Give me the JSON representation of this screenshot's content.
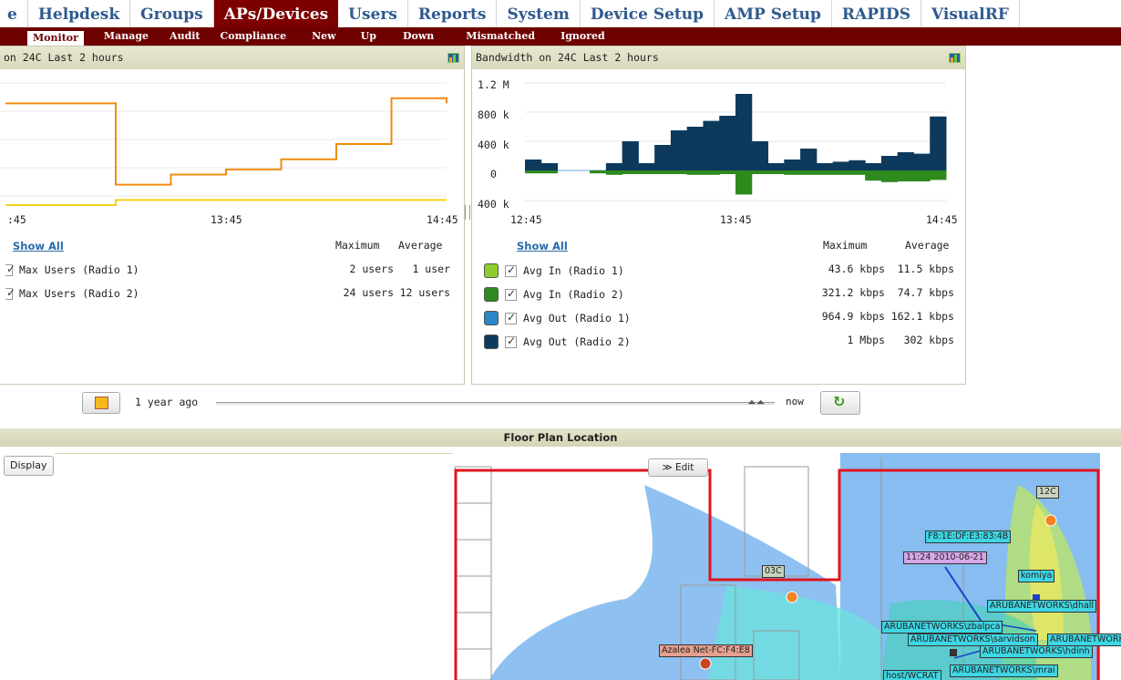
{
  "nav": {
    "tabs": [
      "e",
      "Helpdesk",
      "Groups",
      "APs/Devices",
      "Users",
      "Reports",
      "System",
      "Device Setup",
      "AMP Setup",
      "RAPIDS",
      "VisualRF"
    ],
    "active": "APs/Devices",
    "subtabs": [
      "Monitor",
      "Manage",
      "Audit",
      "Compliance",
      "New",
      "Up",
      "Down",
      "Mismatched",
      "Ignored"
    ],
    "active_sub": "Monitor"
  },
  "users_panel": {
    "title": "on 24C   Last 2 hours",
    "time_labels": [
      ":45",
      "13:45",
      "14:45"
    ],
    "show_all": "Show All",
    "col_max": "Maximum",
    "col_avg": "Average",
    "rows": [
      {
        "label": "Max Users (Radio 1)",
        "max": "2 users",
        "avg": "1 user",
        "color": "#f5d21a"
      },
      {
        "label": "Max Users (Radio 2)",
        "max": "24 users",
        "avg": "12 users",
        "color": "#f08c10"
      }
    ]
  },
  "bw_panel": {
    "title": "Bandwidth on 24C   Last 2 hours",
    "y_ticks": [
      "1.2 M",
      "800 k",
      "400 k",
      "0",
      "400 k"
    ],
    "time_labels": [
      "12:45",
      "13:45",
      "14:45"
    ],
    "show_all": "Show All",
    "col_max": "Maximum",
    "col_avg": "Average",
    "rows": [
      {
        "label": "Avg In (Radio 1)",
        "max": "43.6 kbps",
        "avg": "11.5 kbps",
        "color": "#8ccd2a"
      },
      {
        "label": "Avg In (Radio 2)",
        "max": "321.2 kbps",
        "avg": "74.7 kbps",
        "color": "#2f8a1e"
      },
      {
        "label": "Avg Out (Radio 1)",
        "max": "964.9 kbps",
        "avg": "162.1 kbps",
        "color": "#2a86c8"
      },
      {
        "label": "Avg Out (Radio 2)",
        "max": "1 Mbps",
        "avg": "302 kbps",
        "color": "#0d3a5c"
      }
    ]
  },
  "chart_data": [
    {
      "type": "line",
      "x": [
        "12:45",
        "13:00",
        "13:15",
        "13:30",
        "13:45",
        "14:00",
        "14:15",
        "14:30",
        "14:45"
      ],
      "series": [
        {
          "values": [
            20,
            20,
            4,
            6,
            7,
            9,
            12,
            21,
            20
          ],
          "color": "#f08c10"
        },
        {
          "values": [
            0,
            0,
            1,
            1,
            1,
            1,
            1,
            1,
            1
          ],
          "color": "#f5d21a"
        }
      ]
    },
    {
      "type": "bar",
      "y_ticks": [
        "1.2 M",
        "800 k",
        "400 k",
        "0",
        "400 k"
      ],
      "x_ticks": [
        "12:45",
        "13:45",
        "14:45"
      ],
      "series": [
        {
          "values": [
            150,
            100,
            0,
            0,
            0,
            100,
            400,
            100,
            350,
            550,
            600,
            680,
            750,
            1050,
            400,
            100,
            150,
            300,
            100,
            120,
            140,
            100,
            200,
            250,
            230,
            740
          ],
          "color": "#0d3a5c"
        },
        {
          "values": [
            -40,
            -40,
            0,
            0,
            -40,
            -60,
            -50,
            -50,
            -50,
            -50,
            -60,
            -60,
            -50,
            -330,
            -50,
            -50,
            -60,
            -60,
            -60,
            -60,
            -60,
            -140,
            -160,
            -150,
            -150,
            -130
          ],
          "color": "#2f8a1e"
        }
      ]
    }
  ],
  "slider": {
    "left_label": "1 year ago",
    "right_label": "now"
  },
  "floorplan": {
    "title": "Floor Plan Location",
    "display_label": "Display",
    "edit_label": "≫ Edit",
    "tags": [
      {
        "text": "12C",
        "bg": "#c8d4c0"
      },
      {
        "text": "F8:1E:DF:E3:83:4B",
        "bg": "#3fd6e4"
      },
      {
        "text": "11:24 2010-06-21",
        "bg": "#d6a6e8"
      },
      {
        "text": "03C",
        "bg": "#c8d4c0"
      },
      {
        "text": "komiya",
        "bg": "#3fd6e4"
      },
      {
        "text": "ARUBANETWORKS\\dhall",
        "bg": "#3fd6e4"
      },
      {
        "text": "ARUBANETWORKS\\zbalpca",
        "bg": "#3fd6e4"
      },
      {
        "text": "ARUBANETWORKS\\sarvidson",
        "bg": "#3fd6e4"
      },
      {
        "text": "ARUBANETWORKS\\abear",
        "bg": "#3fd6e4"
      },
      {
        "text": "ARUBANETWORKS\\hdinh",
        "bg": "#3fd6e4"
      },
      {
        "text": "Azalea Net-FC:F4:E8",
        "bg": "#e6a08e"
      },
      {
        "text": "ARUBANETWORKS\\mrai",
        "bg": "#3fd6e4"
      },
      {
        "text": "host/WCRAT",
        "bg": "#3fd6e4"
      }
    ]
  }
}
